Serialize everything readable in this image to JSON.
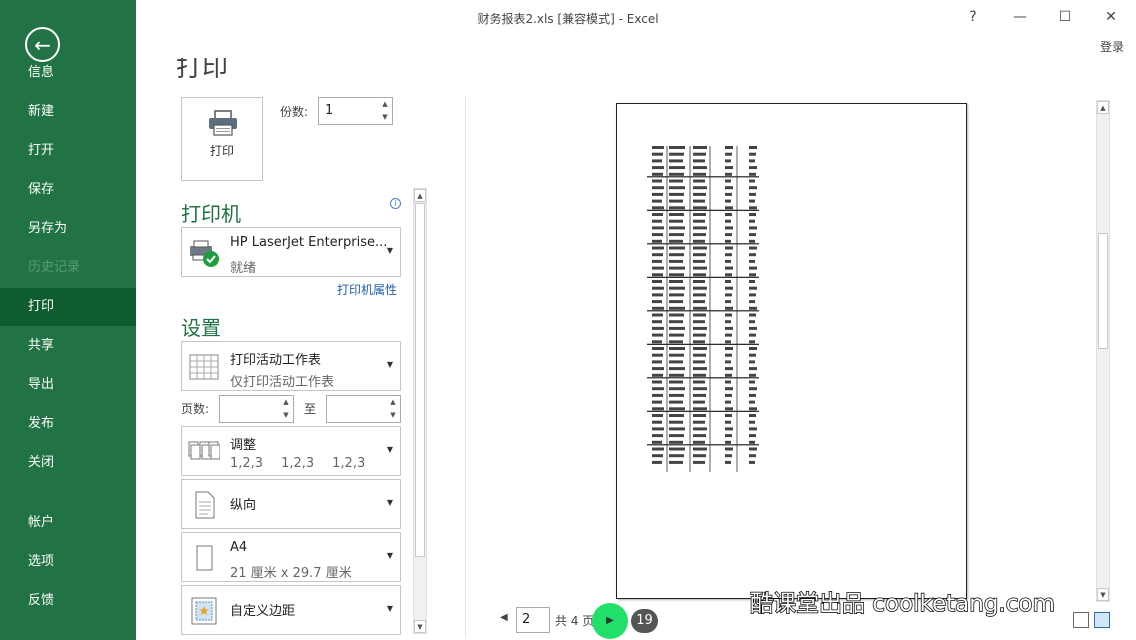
{
  "app": {
    "title": "财务报表2.xls  [兼容模式] - Excel",
    "help": "?",
    "minimize": "—",
    "maximize": "☐",
    "close": "✕",
    "signin": "登录"
  },
  "sidebar": {
    "back_icon": "arrow-left-icon",
    "items": [
      {
        "label": "信息",
        "state": "normal"
      },
      {
        "label": "新建",
        "state": "normal"
      },
      {
        "label": "打开",
        "state": "normal"
      },
      {
        "label": "保存",
        "state": "normal"
      },
      {
        "label": "另存为",
        "state": "normal"
      },
      {
        "label": "历史记录",
        "state": "disabled"
      },
      {
        "label": "打印",
        "state": "active"
      },
      {
        "label": "共享",
        "state": "normal"
      },
      {
        "label": "导出",
        "state": "normal"
      },
      {
        "label": "发布",
        "state": "normal"
      },
      {
        "label": "关闭",
        "state": "normal"
      },
      {
        "label": "帐户",
        "state": "normal"
      },
      {
        "label": "选项",
        "state": "normal"
      },
      {
        "label": "反馈",
        "state": "normal"
      }
    ]
  },
  "print": {
    "heading": "打印",
    "button_label": "打印",
    "copies_label": "份数:",
    "copies_value": "1",
    "printer_section": "打印机",
    "printer_name": "HP LaserJet Enterprise...",
    "printer_status": "就绪",
    "printer_properties": "打印机属性",
    "settings_section": "设置",
    "what_primary": "打印活动工作表",
    "what_secondary": "仅打印活动工作表",
    "pages_label": "页数:",
    "to_label": "至",
    "collate_primary": "调整",
    "collate_secondary": [
      "1,2,3",
      "1,2,3",
      "1,2,3"
    ],
    "orientation": "纵向",
    "paper_primary": "A4",
    "paper_secondary": "21 厘米 x 29.7 厘米",
    "margins": "自定义边距"
  },
  "preview": {
    "current_page": "2",
    "total_pages": "共 4 页",
    "step_badge": "19"
  },
  "watermark": "酷课堂出品 coolketang.com",
  "colors": {
    "accent": "#217346",
    "active_item": "#0e5c2f",
    "highlight": "#21e06a"
  }
}
